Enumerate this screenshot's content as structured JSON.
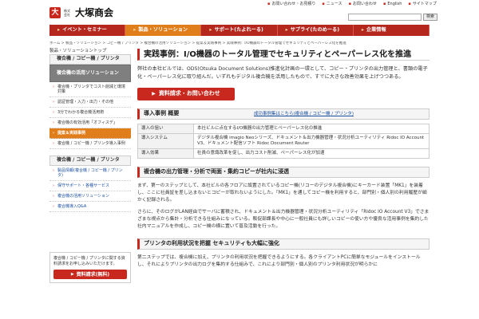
{
  "header": {
    "logo_mark": "大",
    "logo_sub": "株式会社",
    "logo_name": "大塚商会",
    "links": [
      "お問い合わせ・お見積り",
      "ニュース",
      "お問い合わせ",
      "English",
      "サイトマップ"
    ],
    "search_placeholder": "",
    "search_btn": "検索"
  },
  "nav": [
    {
      "label": "イベント・セミナー",
      "active": false
    },
    {
      "label": "製品・ソリューション",
      "active": true
    },
    {
      "label": "サポート(たよれーる)",
      "active": false
    },
    {
      "label": "サプライ(たのめーる)",
      "active": false
    },
    {
      "label": "企業情報",
      "active": false
    }
  ],
  "breadcrumb": "ホーム > 製品・ソリューション > コピー機 / プリンタ > 複合機の活用ソリューション > 提案＆実践事例 > 実践事例：I/O機器のトータル管理でセキュリティとペーパーレス化を推進",
  "sidebar": {
    "top_label": "製品・ソリューショントップ",
    "group1": "複合機 / コピー機 / プリンタ",
    "group2": "複合機の活用ソリューション",
    "group2_items": [
      "複合機・プリンタでコスト削減と環境対策",
      "認証管理・入力・出力・その他",
      "3分でわかる複合機活用術",
      "複合機の有効活用「オフィスデ」"
    ],
    "active_item": "提案＆実践事例",
    "after_items": [
      "複合機 / コピー機 / プリンタ導入事例"
    ],
    "group3": "複合機 / コピー機 / プリンタ",
    "group3_items": [
      "製品情報(複合機 / コピー機 / プリンタ)",
      "保守サポート・各種サービス",
      "複合機の活用ソリューション",
      "複合機導入Q&A"
    ],
    "mini_text": "複合機 / コピー機 / プリンタに関する資料請求をお申し込みいただけます。",
    "mini_btn": "資料請求(無料)"
  },
  "main": {
    "title": "実践事例：I/O機器のトータル管理でセキュリティとペーパーレス化を推進",
    "intro": "弊社の本社ビルでは、ODS(Otsuka Document Solutions)推進化計画の一環として、コピー・プリンタの出力管理と、書類の電子化・ペーパーレス化に取り組んだ。いずれもデジタル複合機を活用したもので、すでに大きな改善効果を上げつつある。",
    "request_btn": "資料請求・お問い合わせ",
    "case_link": "成功事例集はこちら(複合機 / コピー機 / プリンタ)",
    "case_heading": "導入事例 概要",
    "table": [
      {
        "k": "導入の狙い",
        "v": "本社ビルに点在するI/O機器の出力管理とペーパーレス化の推進"
      },
      {
        "k": "導入システム",
        "v": "デジタル複合機 imagio Neoシリーズ、ドキュメント＆出力機器管理・状況分析ユーティリティ Ridoc IO Account V3、ドキュメント配信ソフト Ridoc Document Router"
      },
      {
        "k": "導入効果",
        "v": "社員の意識改革を促し、出力コスト削減、ペーパーレス化が加速"
      }
    ],
    "sec1_heading": "複合機の出力管理・分析で両面・集約コピーが社内に浸透",
    "sec1_p1": "まず、第一のステップとして、本社ビルの各フロアに設置されているコピー機(リコーのデジタル複合機)にキーカード装置「MK1」を装着し、ここに社員証を差し込まないとコピーが取れないようにした。「MK1」を通してコピー機を利用すると、部門別・個人別の利用履歴が細かく記録される。",
    "sec1_p2": "さらに、そのログがLAN経由でサーバに蓄積され、ドキュメント＆出力機器管理・状況分析ユーティリティ「Ridoc IO Account V3」でさまざまな視点から集計・分析できる仕組みになっている。販促部課長や中心に一般社員にも詳しいコピーの使い方や優良な活用事例を集約した社内マニュアルを作成し、コピー機の横に置いて普及活動を行った。",
    "sec2_heading": "プリンタの利用状況を把握 セキュリティも大幅に強化",
    "sec2_p1": "第二ステップでは、複合機に加え、プリンタの利用状況を把握できるようにする。各クライアントPCに簡単なモジュールをインストールし、それによりプリンタの出力ログを集約する仕組みで、これにより部門別・個人別のプリンタ利用状況が明らかに"
  }
}
